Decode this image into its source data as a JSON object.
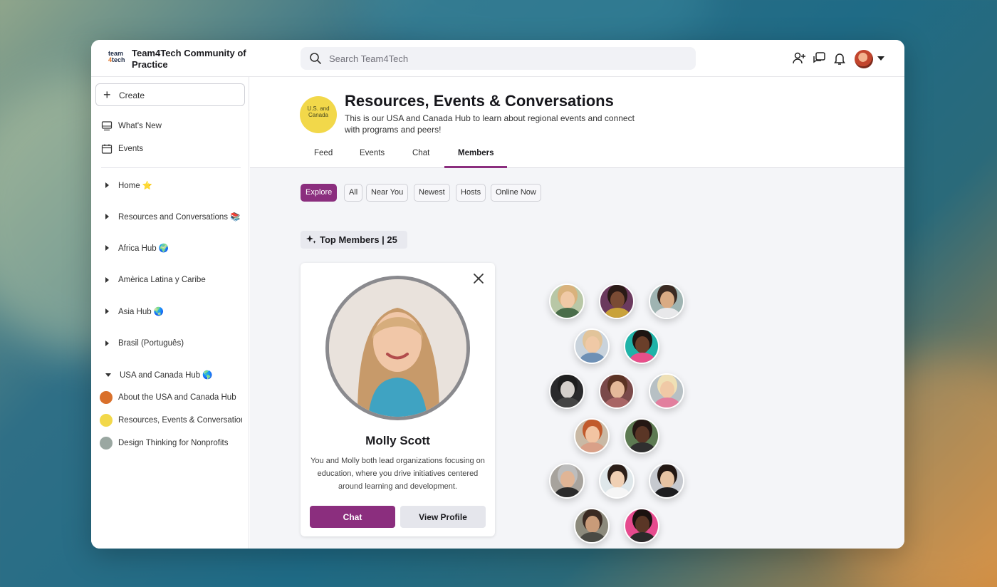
{
  "site": {
    "logo_top": "team",
    "logo_num": "4",
    "logo_bottom": "tech",
    "title": "Team4Tech Community of Practice"
  },
  "search": {
    "placeholder": "Search Team4Tech"
  },
  "topbar_icons": [
    "add-user-icon",
    "chat-bubbles-icon",
    "bell-icon"
  ],
  "sidebar": {
    "create_label": "Create",
    "items": [
      {
        "label": "What's New",
        "icon": "monitor-icon"
      },
      {
        "label": "Events",
        "icon": "calendar-icon"
      }
    ],
    "groups": [
      {
        "label": "Home ⭐",
        "expanded": false
      },
      {
        "label": "Resources and Conversations 📚",
        "expanded": false
      },
      {
        "label": "Africa Hub 🌍",
        "expanded": false
      },
      {
        "label": "Amèrica Latina y Caribe",
        "expanded": false
      },
      {
        "label": "Asia Hub 🌏",
        "expanded": false
      },
      {
        "label": "Brasil (Português)",
        "expanded": false
      },
      {
        "label": "USA and Canada Hub 🌎",
        "expanded": true
      }
    ],
    "sub_items": [
      {
        "label": "About the USA and Canada Hub",
        "color": "#d9702b"
      },
      {
        "label": "Resources, Events & Conversations",
        "color": "#f2d84a"
      },
      {
        "label": "Design Thinking for Nonprofits",
        "color": "#9aa7a1"
      }
    ]
  },
  "hub": {
    "logo_text": "U.S. and Canada",
    "title": "Resources, Events & Conversations",
    "description": "This is our USA and Canada Hub to learn about regional events and connect with programs and peers!"
  },
  "tabs": [
    "Feed",
    "Events",
    "Chat",
    "Members"
  ],
  "active_tab": "Members",
  "filters": [
    "Explore",
    "All",
    "Near You",
    "Newest",
    "Hosts",
    "Online Now"
  ],
  "active_filter": "Explore",
  "top_members": {
    "label": "Top Members | 25"
  },
  "profile_card": {
    "name": "Molly Scott",
    "description": "You and Molly both lead organizations focusing on education, where you drive initiatives centered around learning and development.",
    "chat_label": "Chat",
    "view_label": "View Profile"
  },
  "colors": {
    "accent": "#8b2e7e",
    "hub_yellow": "#f2d84a"
  }
}
